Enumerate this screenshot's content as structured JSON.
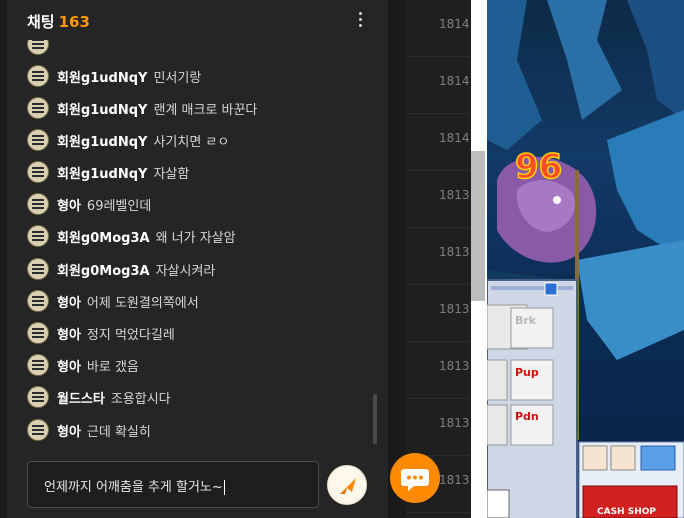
{
  "chat": {
    "title": "채팅",
    "count": "163",
    "messages": [
      {
        "nick": "회원g1udNqY",
        "text": "민서기랑"
      },
      {
        "nick": "회원g1udNqY",
        "text": "랜계 매크로 바꾼다"
      },
      {
        "nick": "회원g1udNqY",
        "text": "사기치면 ㄹㅇ"
      },
      {
        "nick": "회원g1udNqY",
        "text": "자살함"
      },
      {
        "nick": "형아",
        "text": "69레벨인데"
      },
      {
        "nick": "회원g0Mog3A",
        "text": "왜 너가 자살암"
      },
      {
        "nick": "회원g0Mog3A",
        "text": "자살시켜라"
      },
      {
        "nick": "형아",
        "text": "어제 도원결의쪽에서"
      },
      {
        "nick": "형아",
        "text": "정지 먹었다길레"
      },
      {
        "nick": "형아",
        "text": "바로 갰음"
      },
      {
        "nick": "월드스타",
        "text": "조용합시다"
      },
      {
        "nick": "형아",
        "text": "근데 확실히"
      }
    ],
    "input_value": "언제까지 어깨춤을 추게 할거노~"
  },
  "list_numbers": [
    "1814",
    "1814",
    "1814",
    "1813",
    "1813",
    "1813",
    "1813",
    "1813",
    "1813"
  ],
  "colors": {
    "accent": "#ff9800",
    "fab": "#ff8a00"
  },
  "icons": {
    "menu": "kebab-icon",
    "send": "paper-plane-icon",
    "chat_fab": "speech-bubble-icon"
  }
}
